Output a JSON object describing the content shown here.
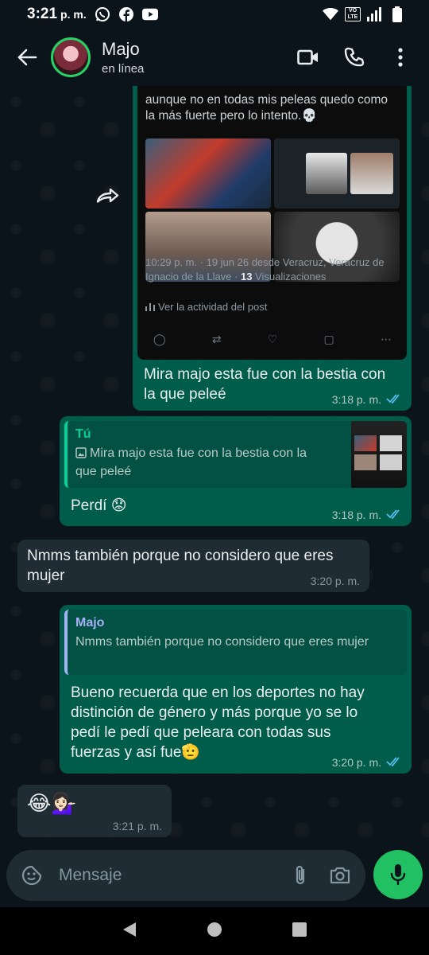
{
  "status_bar": {
    "time": "3:21",
    "ampm": "p. m.",
    "icons_left": [
      "whatsapp-icon",
      "facebook-icon",
      "youtube-icon"
    ],
    "icons_right": [
      "wifi-icon",
      "volte-icon",
      "signal-icon",
      "battery-icon"
    ],
    "volte_label": "VO LTE"
  },
  "header": {
    "contact_name": "Majo",
    "contact_status": "en línea",
    "actions": [
      "video-call-icon",
      "voice-call-icon",
      "more-options-icon"
    ]
  },
  "messages": [
    {
      "direction": "out",
      "post": {
        "text": "aunque no en todas mis peleas quedo como la más fuerte pero lo intento.💀",
        "meta_line": "10:29 p. m. · 19 jun 26 desde Veracruz, Veracruz de Ignacio de la Llave · ",
        "views_count": "13",
        "views_label": " Visualizaciones",
        "activity": "Ver la actividad del post"
      },
      "caption": "Mira majo esta fue con la bestia con la que peleé",
      "time": "3:18 p. m.",
      "status": "read"
    },
    {
      "direction": "out",
      "quote": {
        "author": "Tú",
        "text": "Mira majo esta fue con la bestia con la que peleé"
      },
      "text": "Perdí 😟",
      "time": "3:18 p. m.",
      "status": "read"
    },
    {
      "direction": "in",
      "text": "Nmms también porque no considero que eres mujer",
      "time": "3:20 p. m."
    },
    {
      "direction": "out",
      "quote": {
        "author": "Majo",
        "text": "Nmms también porque no considero que eres mujer"
      },
      "text": "Bueno recuerda que en los deportes no hay distinción de género y más porque yo se lo pedí le pedí que peleara con todas sus fuerzas y así fue🫡",
      "time": "3:20 p. m.",
      "status": "read"
    },
    {
      "direction": "in",
      "text": "😂💁🏻‍♀️",
      "time": "3:21 p. m."
    }
  ],
  "composer": {
    "placeholder": "Mensaje"
  },
  "colors": {
    "accent": "#25d366",
    "outgoing_bubble": "#005c4b",
    "incoming_bubble": "#202c33",
    "background": "#0b141a",
    "read_ticks": "#53bdeb"
  }
}
